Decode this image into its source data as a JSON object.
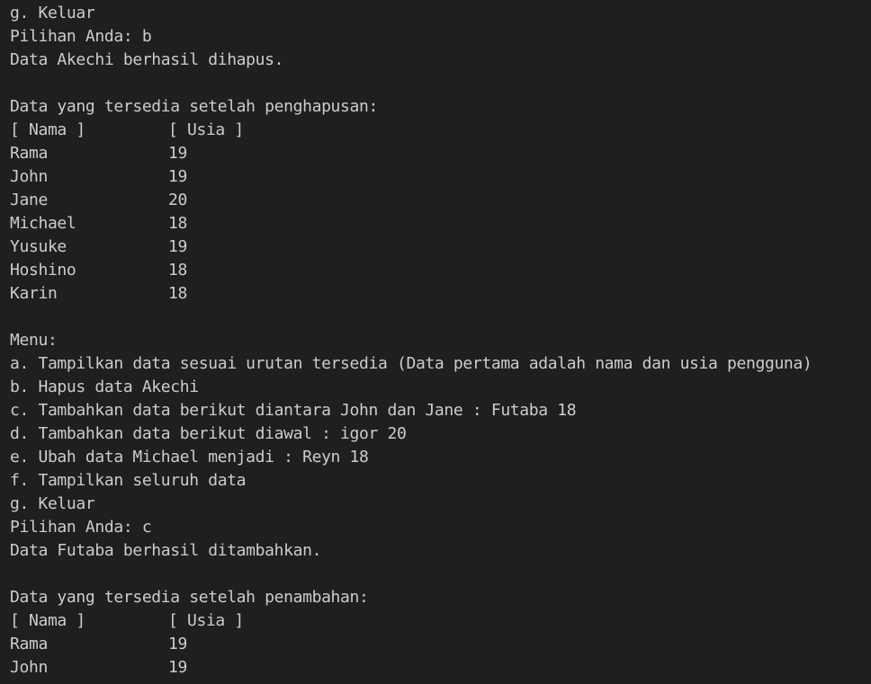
{
  "terminal": {
    "lines": [
      {
        "type": "text",
        "text": "g. Keluar"
      },
      {
        "type": "text",
        "text": "Pilihan Anda: b"
      },
      {
        "type": "text",
        "text": "Data Akechi berhasil dihapus."
      },
      {
        "type": "text",
        "text": ""
      },
      {
        "type": "text",
        "text": "Data yang tersedia setelah penghapusan:"
      },
      {
        "type": "row",
        "name": "[ Nama ]",
        "age": "[ Usia ]"
      },
      {
        "type": "row",
        "name": "Rama",
        "age": "19"
      },
      {
        "type": "row",
        "name": "John",
        "age": "19"
      },
      {
        "type": "row",
        "name": "Jane",
        "age": "20"
      },
      {
        "type": "row",
        "name": "Michael",
        "age": "18"
      },
      {
        "type": "row",
        "name": "Yusuke",
        "age": "19"
      },
      {
        "type": "row",
        "name": "Hoshino",
        "age": "18"
      },
      {
        "type": "row",
        "name": "Karin",
        "age": "18"
      },
      {
        "type": "text",
        "text": ""
      },
      {
        "type": "text",
        "text": "Menu:"
      },
      {
        "type": "text",
        "text": "a. Tampilkan data sesuai urutan tersedia (Data pertama adalah nama dan usia pengguna)"
      },
      {
        "type": "text",
        "text": "b. Hapus data Akechi"
      },
      {
        "type": "text",
        "text": "c. Tambahkan data berikut diantara John dan Jane : Futaba 18"
      },
      {
        "type": "text",
        "text": "d. Tambahkan data berikut diawal : igor 20"
      },
      {
        "type": "text",
        "text": "e. Ubah data Michael menjadi : Reyn 18"
      },
      {
        "type": "text",
        "text": "f. Tampilkan seluruh data"
      },
      {
        "type": "text",
        "text": "g. Keluar"
      },
      {
        "type": "text",
        "text": "Pilihan Anda: c"
      },
      {
        "type": "text",
        "text": "Data Futaba berhasil ditambahkan."
      },
      {
        "type": "text",
        "text": ""
      },
      {
        "type": "text",
        "text": "Data yang tersedia setelah penambahan:"
      },
      {
        "type": "row",
        "name": "[ Nama ]",
        "age": "[ Usia ]"
      },
      {
        "type": "row",
        "name": "Rama",
        "age": "19"
      },
      {
        "type": "row",
        "name": "John",
        "age": "19"
      }
    ]
  },
  "colors": {
    "background": "#1f1f1f",
    "foreground": "#cccccc"
  }
}
